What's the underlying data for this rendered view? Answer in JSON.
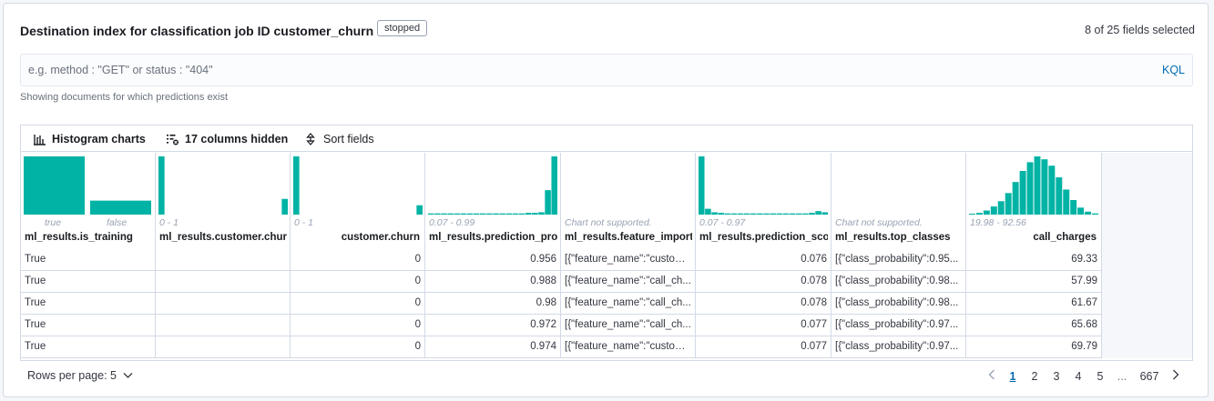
{
  "header": {
    "title": "Destination index for classification job ID customer_churn",
    "status_badge": "stopped",
    "fields_selected": "8 of 25 fields selected"
  },
  "search": {
    "placeholder": "e.g. method : \"GET\" or status : \"404\"",
    "language_label": "KQL",
    "hint": "Showing documents for which predictions exist"
  },
  "toolbar": {
    "histogram_label": "Histogram charts",
    "hidden_columns_label": "17 columns hidden",
    "sort_label": "Sort fields"
  },
  "columns": [
    {
      "name": "ml_results.is_training",
      "range_left": "true",
      "range_right": "false",
      "chart": "bool",
      "align": "left"
    },
    {
      "name": "ml_results.customer.churn",
      "range": "0 - 1",
      "chart": "bins",
      "align": "left"
    },
    {
      "name": "customer.churn",
      "range": "0 - 1",
      "chart": "bins",
      "align": "right"
    },
    {
      "name": "ml_results.prediction_probability",
      "range": "0.07 - 0.99",
      "chart": "bins",
      "align": "left"
    },
    {
      "name": "ml_results.feature_importance",
      "range": "Chart not supported.",
      "chart": "none",
      "align": "left"
    },
    {
      "name": "ml_results.prediction_score",
      "range": "0.07 - 0.97",
      "chart": "bins",
      "align": "left"
    },
    {
      "name": "ml_results.top_classes",
      "range": "Chart not supported.",
      "chart": "none",
      "align": "left"
    },
    {
      "name": "call_charges",
      "range": "19.98 - 92.56",
      "chart": "bins",
      "align": "right"
    }
  ],
  "histograms": {
    "is_training": [
      1.0,
      0.24
    ],
    "ml_customer_churn": [
      1.0,
      0,
      0,
      0,
      0,
      0,
      0,
      0,
      0,
      0,
      0,
      0,
      0,
      0,
      0,
      0,
      0,
      0,
      0,
      0.27
    ],
    "customer_churn": [
      1.0,
      0,
      0,
      0,
      0,
      0,
      0,
      0,
      0,
      0,
      0,
      0,
      0,
      0,
      0,
      0,
      0,
      0,
      0,
      0.16
    ],
    "prediction_probability": [
      0.02,
      0.02,
      0.02,
      0.02,
      0.02,
      0.02,
      0.02,
      0.02,
      0.02,
      0.02,
      0.02,
      0.02,
      0.02,
      0.02,
      0.02,
      0.03,
      0.03,
      0.04,
      0.42,
      1.0
    ],
    "prediction_score": [
      1.0,
      0.1,
      0.04,
      0.03,
      0.02,
      0.02,
      0.02,
      0.02,
      0.02,
      0.02,
      0.02,
      0.02,
      0.02,
      0.02,
      0.02,
      0.02,
      0.02,
      0.03,
      0.06,
      0.04
    ],
    "call_charges": [
      0.01,
      0.03,
      0.07,
      0.14,
      0.23,
      0.37,
      0.56,
      0.75,
      0.9,
      1.0,
      0.95,
      0.84,
      0.64,
      0.43,
      0.25,
      0.12,
      0.05,
      0.02
    ]
  },
  "rows": [
    [
      "True",
      "",
      "0",
      "0.956",
      "[{\"feature_name\":\"custom...",
      "0.076",
      "[{\"class_probability\":0.95...",
      "69.33"
    ],
    [
      "True",
      "",
      "0",
      "0.988",
      "[{\"feature_name\":\"call_ch...",
      "0.078",
      "[{\"class_probability\":0.98...",
      "57.99"
    ],
    [
      "True",
      "",
      "0",
      "0.98",
      "[{\"feature_name\":\"call_ch...",
      "0.078",
      "[{\"class_probability\":0.98...",
      "61.67"
    ],
    [
      "True",
      "",
      "0",
      "0.972",
      "[{\"feature_name\":\"call_ch...",
      "0.077",
      "[{\"class_probability\":0.97...",
      "65.68"
    ],
    [
      "True",
      "",
      "0",
      "0.974",
      "[{\"feature_name\":\"custom...",
      "0.077",
      "[{\"class_probability\":0.97...",
      "69.79"
    ]
  ],
  "footer": {
    "rows_per_page": "Rows per page: 5",
    "pages": [
      "1",
      "2",
      "3",
      "4",
      "5"
    ],
    "ellipsis": "...",
    "last_page": "667",
    "active_page": "1"
  },
  "colors": {
    "bar": "#00b3a4",
    "link": "#006bb4",
    "border": "#d3dae6"
  }
}
